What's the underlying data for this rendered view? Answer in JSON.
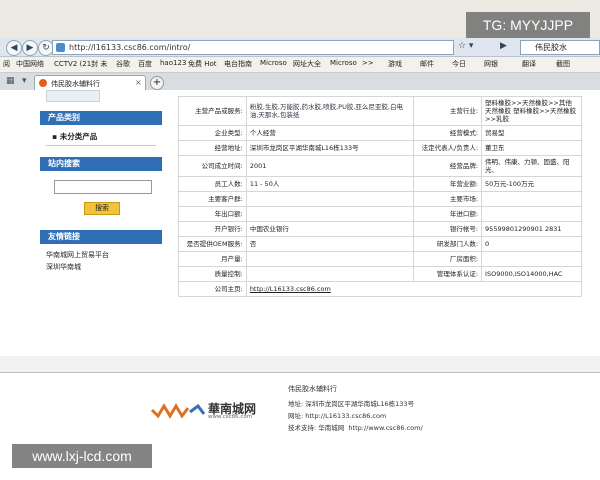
{
  "overlays": {
    "top_right": "TG: MYYJJPP",
    "bottom_left": "www.lxj-lcd.com"
  },
  "browser": {
    "url": "http://l16133.csc86.com/intro/",
    "search_text": "伟民胶水",
    "bookmarks": [
      "阅",
      "中国网络",
      "CCTV2 (21封 未",
      "谷歌",
      "百度",
      "hao123",
      "免费 Hot",
      "电台指南",
      "Microso",
      "网址大全",
      "Microso",
      ">>"
    ],
    "toolbar_items": [
      "游戏",
      "邮件",
      "今日",
      "网银",
      "翻译",
      "截图"
    ],
    "tab_title": "伟民胶水辅料行"
  },
  "sidebar": {
    "section1_title": "产品类别",
    "section1_item": "未分类产品",
    "section2_title": "站内搜索",
    "search_button": "搜索",
    "section3_title": "友情链接",
    "links": [
      "华南城网上贸易平台",
      "深圳华南城"
    ]
  },
  "table": {
    "rows": [
      {
        "l1": "主营产品或服务:",
        "v1": "粉胶,生胶,万能胶,药水胶,喷胶,PU胶,亚么尼亚胶,白电油,天那水,包装纸",
        "l2": "主营行业:",
        "v2": "塑料橡胶>>天然橡胶>>其他天然橡胶 塑料橡胶>>天然橡胶>>乳胶"
      },
      {
        "l1": "企业类型:",
        "v1": "个人经营",
        "l2": "经营模式:",
        "v2": "贸易型"
      },
      {
        "l1": "经营地址:",
        "v1": "深圳市龙岗区平湖华南城L16栋133号",
        "l2": "法定代表人/负责人:",
        "v2": "董卫东"
      },
      {
        "l1": "公司成立时间:",
        "v1": "2001",
        "l2": "经营品牌:",
        "v2": "伟明、伟康、力顿、固盛、阳光、"
      },
      {
        "l1": "员工人数:",
        "v1": "11 - 50人",
        "l2": "年营业额:",
        "v2": "50万元-100万元"
      },
      {
        "l1": "主要客户群:",
        "v1": "",
        "l2": "主要市场:",
        "v2": ""
      },
      {
        "l1": "年出口额:",
        "v1": "",
        "l2": "年进口额:",
        "v2": ""
      },
      {
        "l1": "开户银行:",
        "v1": "中国农业银行",
        "l2": "银行帐号:",
        "v2": "95599801290901 2831"
      },
      {
        "l1": "是否提供OEM服务:",
        "v1": "否",
        "l2": "研发部门人数:",
        "v2": "0"
      },
      {
        "l1": "月产量:",
        "v1": "",
        "l2": "厂房面积:",
        "v2": ""
      },
      {
        "l1": "质量控制:",
        "v1": "",
        "l2": "管理体系认证:",
        "v2": "ISO9000,ISO14000,HAC"
      }
    ],
    "homepage_label": "公司主页:",
    "homepage_url": "http://L16133.csc86.com"
  },
  "footer": {
    "logo_text": "華南城网",
    "logo_sub": "www.csc86.com",
    "company": "伟民胶水辅料行",
    "address": "地址: 深圳市龙岗区平湖华南城L16栋133号",
    "website": "网址: http://L16133.csc86.com",
    "support": "技术支持: 华南城网",
    "support_url": "http://www.csc86.com/"
  }
}
